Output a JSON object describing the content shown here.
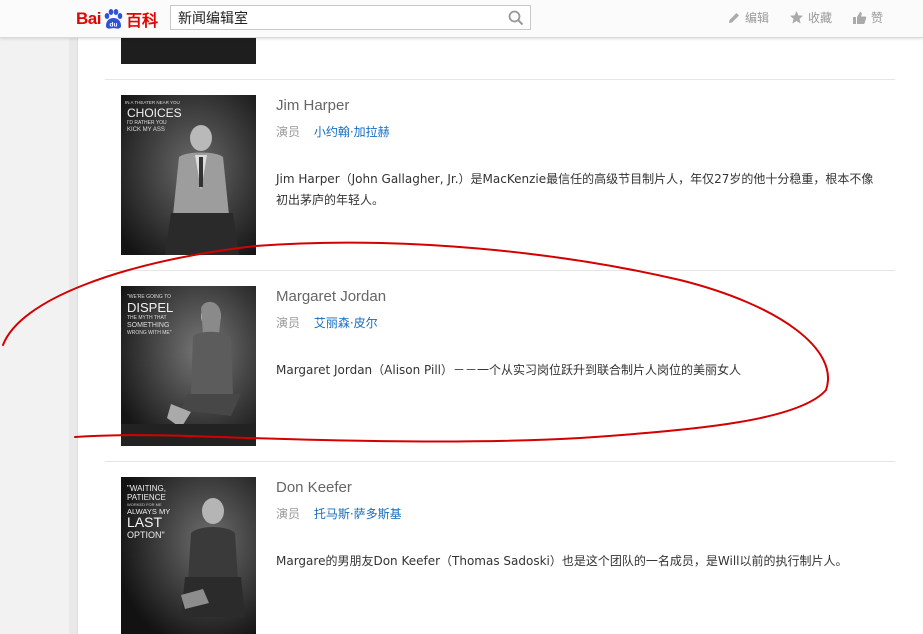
{
  "header": {
    "logo_text": "Bai",
    "logo_du": "du",
    "logo_baike": "百科",
    "search_value": "新闻编辑室",
    "actions": [
      {
        "label": "编辑",
        "icon": "pencil-icon"
      },
      {
        "label": "收藏",
        "icon": "star-icon"
      },
      {
        "label": "赞",
        "icon": "thumbs-up-icon"
      }
    ]
  },
  "roles": [
    {
      "name": "Jim Harper",
      "actor_label": "演员",
      "actor_name": "小约翰·加拉赫",
      "description": "Jim Harper（John Gallagher, Jr.）是MacKenzie最信任的高级节目制片人，年仅27岁的他十分稳重，根本不像初出茅庐的年轻人。",
      "poster_text": [
        "IN A THEATER NEAR YOU",
        "CHOICES",
        "I'D RATHER YOU",
        "KICK MY ASS"
      ]
    },
    {
      "name": "Margaret Jordan",
      "actor_label": "演员",
      "actor_name": "艾丽森·皮尔",
      "description": "Margaret Jordan（Alison Pill）－－一个从实习岗位跃升到联合制片人岗位的美丽女人",
      "poster_text": [
        "\"WE'RE GOING TO",
        "DISPEL",
        "THE MYTH THAT",
        "SOMETHING",
        "WRONG WITH ME\""
      ]
    },
    {
      "name": "Don Keefer",
      "actor_label": "演员",
      "actor_name": "托马斯·萨多斯基",
      "description": "Margare的男朋友Don Keefer（Thomas Sadoski）也是这个团队的一名成员，是Will以前的执行制片人。",
      "poster_text": [
        "\"WAITING,",
        "PATIENCE",
        "WORKED FOR ME",
        "ALWAYS MY",
        "LAST",
        "OPTION\""
      ]
    }
  ],
  "colors": {
    "brand_red": "#e10601",
    "brand_blue": "#2d52d6",
    "link_blue": "#136ec2",
    "annotation_red": "#d40000"
  }
}
